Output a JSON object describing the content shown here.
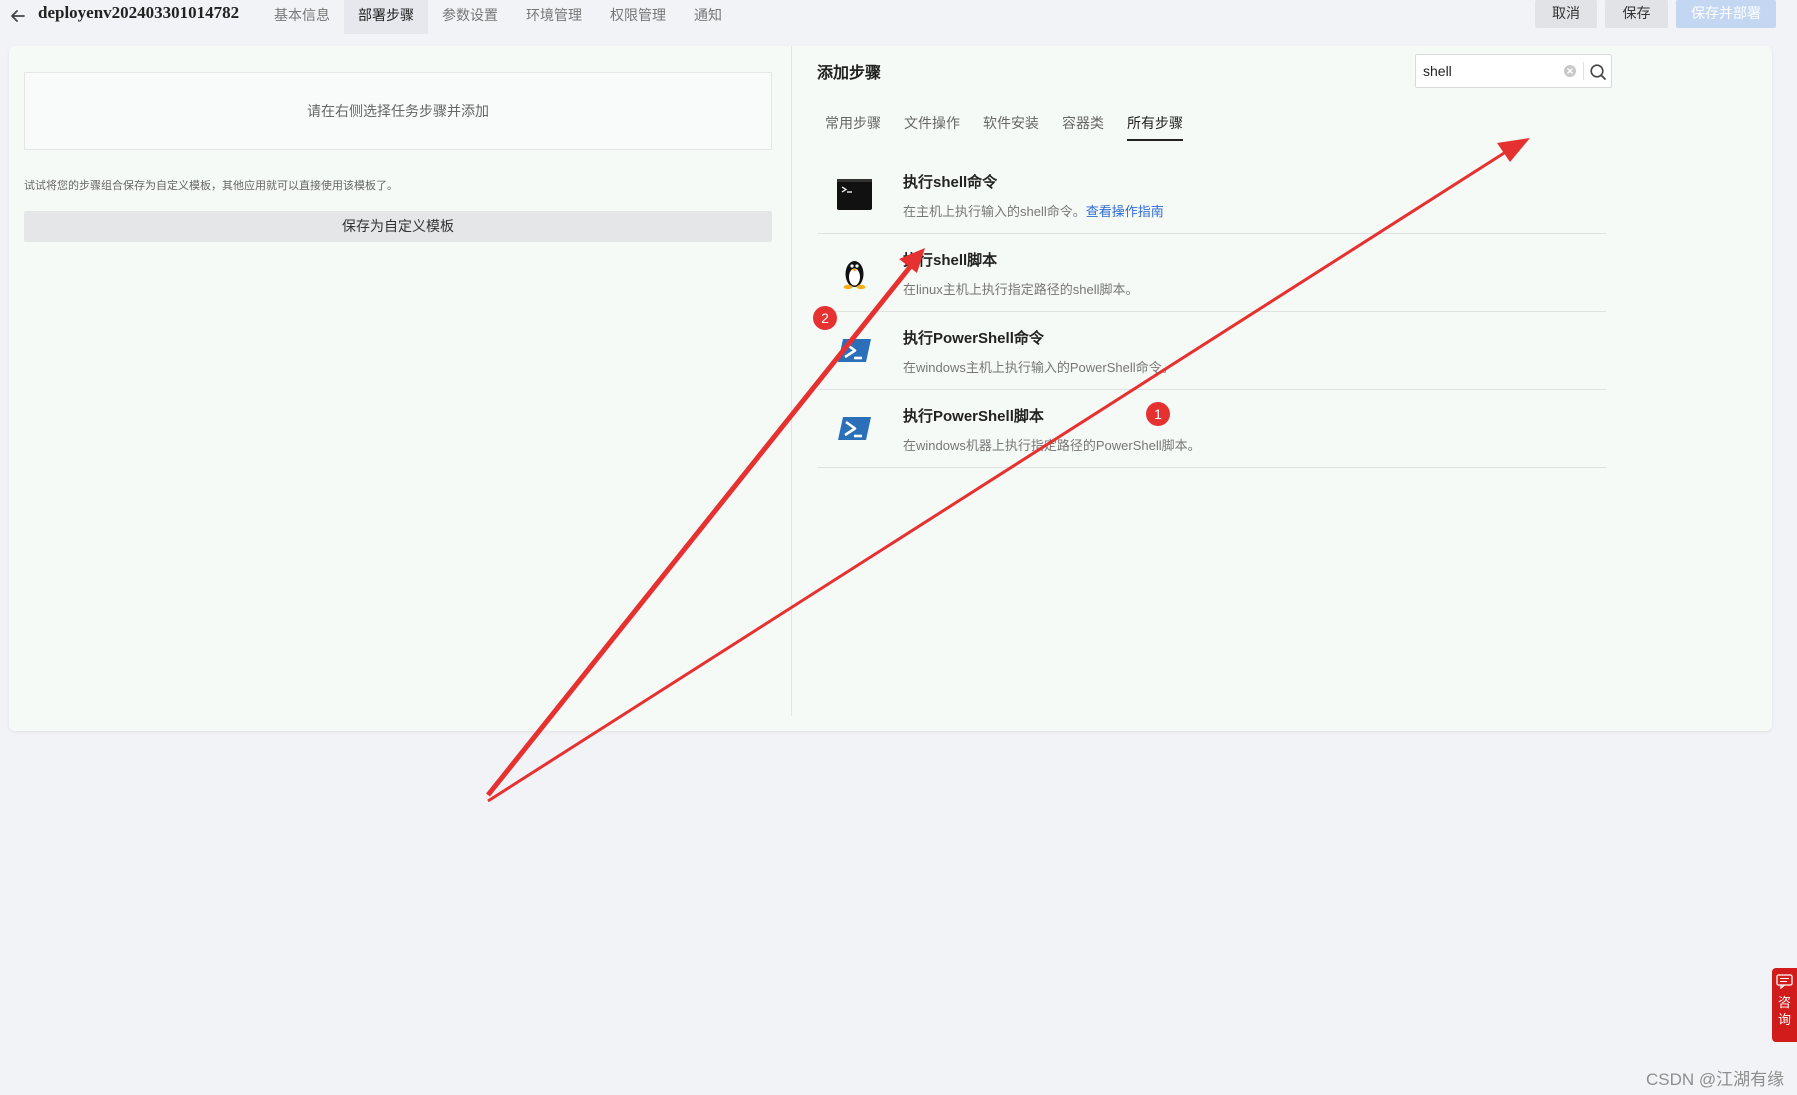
{
  "header": {
    "title": "deployenv202403301014782",
    "tabs": [
      {
        "label": "基本信息"
      },
      {
        "label": "部署步骤"
      },
      {
        "label": "参数设置"
      },
      {
        "label": "环境管理"
      },
      {
        "label": "权限管理"
      },
      {
        "label": "通知"
      }
    ],
    "active_tab": "部署步骤",
    "buttons": {
      "cancel": "取消",
      "save": "保存",
      "save_deploy": "保存并部署"
    }
  },
  "left_panel": {
    "placeholder": "请在右侧选择任务步骤并添加",
    "hint": "试试将您的步骤组合保存为自定义模板，其他应用就可以直接使用该模板了。",
    "save_template_label": "保存为自定义模板"
  },
  "right_panel": {
    "title": "添加步骤",
    "search": {
      "value": "shell"
    },
    "categories": [
      {
        "label": "常用步骤"
      },
      {
        "label": "文件操作"
      },
      {
        "label": "软件安装"
      },
      {
        "label": "容器类"
      },
      {
        "label": "所有步骤"
      }
    ],
    "active_category": "所有步骤",
    "steps": [
      {
        "name": "执行shell命令",
        "desc": "在主机上执行输入的shell命令。",
        "link": "查看操作指南",
        "icon": "terminal-icon"
      },
      {
        "name": "执行shell脚本",
        "desc": "在linux主机上执行指定路径的shell脚本。",
        "icon": "linux-penguin-icon"
      },
      {
        "name": "执行PowerShell命令",
        "desc": "在windows主机上执行输入的PowerShell命令。",
        "icon": "powershell-icon"
      },
      {
        "name": "执行PowerShell脚本",
        "desc": "在windows机器上执行指定路径的PowerShell脚本。",
        "icon": "powershell-icon"
      }
    ]
  },
  "annotations": {
    "badge_1": "1",
    "badge_2": "2",
    "color": "#e63131"
  },
  "consult_widget": {
    "label": "咨询"
  },
  "watermark": "CSDN @江湖有缘",
  "colors": {
    "background": "#f1f3f7",
    "card": "#f6faf7",
    "link": "#2f6bd6",
    "primary_disabled": "#c4d7f2"
  }
}
